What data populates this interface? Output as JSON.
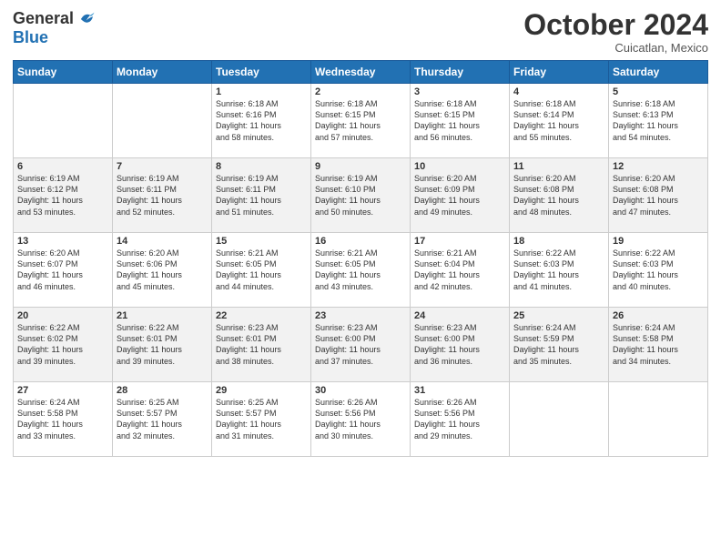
{
  "header": {
    "logo_general": "General",
    "logo_blue": "Blue",
    "month_title": "October 2024",
    "location": "Cuicatlan, Mexico"
  },
  "weekdays": [
    "Sunday",
    "Monday",
    "Tuesday",
    "Wednesday",
    "Thursday",
    "Friday",
    "Saturday"
  ],
  "days": [
    {
      "num": "",
      "sunrise": "",
      "sunset": "",
      "daylight": ""
    },
    {
      "num": "",
      "sunrise": "",
      "sunset": "",
      "daylight": ""
    },
    {
      "num": "1",
      "sunrise": "Sunrise: 6:18 AM",
      "sunset": "Sunset: 6:16 PM",
      "daylight": "Daylight: 11 hours and 58 minutes."
    },
    {
      "num": "2",
      "sunrise": "Sunrise: 6:18 AM",
      "sunset": "Sunset: 6:15 PM",
      "daylight": "Daylight: 11 hours and 57 minutes."
    },
    {
      "num": "3",
      "sunrise": "Sunrise: 6:18 AM",
      "sunset": "Sunset: 6:15 PM",
      "daylight": "Daylight: 11 hours and 56 minutes."
    },
    {
      "num": "4",
      "sunrise": "Sunrise: 6:18 AM",
      "sunset": "Sunset: 6:14 PM",
      "daylight": "Daylight: 11 hours and 55 minutes."
    },
    {
      "num": "5",
      "sunrise": "Sunrise: 6:18 AM",
      "sunset": "Sunset: 6:13 PM",
      "daylight": "Daylight: 11 hours and 54 minutes."
    },
    {
      "num": "6",
      "sunrise": "Sunrise: 6:19 AM",
      "sunset": "Sunset: 6:12 PM",
      "daylight": "Daylight: 11 hours and 53 minutes."
    },
    {
      "num": "7",
      "sunrise": "Sunrise: 6:19 AM",
      "sunset": "Sunset: 6:11 PM",
      "daylight": "Daylight: 11 hours and 52 minutes."
    },
    {
      "num": "8",
      "sunrise": "Sunrise: 6:19 AM",
      "sunset": "Sunset: 6:11 PM",
      "daylight": "Daylight: 11 hours and 51 minutes."
    },
    {
      "num": "9",
      "sunrise": "Sunrise: 6:19 AM",
      "sunset": "Sunset: 6:10 PM",
      "daylight": "Daylight: 11 hours and 50 minutes."
    },
    {
      "num": "10",
      "sunrise": "Sunrise: 6:20 AM",
      "sunset": "Sunset: 6:09 PM",
      "daylight": "Daylight: 11 hours and 49 minutes."
    },
    {
      "num": "11",
      "sunrise": "Sunrise: 6:20 AM",
      "sunset": "Sunset: 6:08 PM",
      "daylight": "Daylight: 11 hours and 48 minutes."
    },
    {
      "num": "12",
      "sunrise": "Sunrise: 6:20 AM",
      "sunset": "Sunset: 6:08 PM",
      "daylight": "Daylight: 11 hours and 47 minutes."
    },
    {
      "num": "13",
      "sunrise": "Sunrise: 6:20 AM",
      "sunset": "Sunset: 6:07 PM",
      "daylight": "Daylight: 11 hours and 46 minutes."
    },
    {
      "num": "14",
      "sunrise": "Sunrise: 6:20 AM",
      "sunset": "Sunset: 6:06 PM",
      "daylight": "Daylight: 11 hours and 45 minutes."
    },
    {
      "num": "15",
      "sunrise": "Sunrise: 6:21 AM",
      "sunset": "Sunset: 6:05 PM",
      "daylight": "Daylight: 11 hours and 44 minutes."
    },
    {
      "num": "16",
      "sunrise": "Sunrise: 6:21 AM",
      "sunset": "Sunset: 6:05 PM",
      "daylight": "Daylight: 11 hours and 43 minutes."
    },
    {
      "num": "17",
      "sunrise": "Sunrise: 6:21 AM",
      "sunset": "Sunset: 6:04 PM",
      "daylight": "Daylight: 11 hours and 42 minutes."
    },
    {
      "num": "18",
      "sunrise": "Sunrise: 6:22 AM",
      "sunset": "Sunset: 6:03 PM",
      "daylight": "Daylight: 11 hours and 41 minutes."
    },
    {
      "num": "19",
      "sunrise": "Sunrise: 6:22 AM",
      "sunset": "Sunset: 6:03 PM",
      "daylight": "Daylight: 11 hours and 40 minutes."
    },
    {
      "num": "20",
      "sunrise": "Sunrise: 6:22 AM",
      "sunset": "Sunset: 6:02 PM",
      "daylight": "Daylight: 11 hours and 39 minutes."
    },
    {
      "num": "21",
      "sunrise": "Sunrise: 6:22 AM",
      "sunset": "Sunset: 6:01 PM",
      "daylight": "Daylight: 11 hours and 39 minutes."
    },
    {
      "num": "22",
      "sunrise": "Sunrise: 6:23 AM",
      "sunset": "Sunset: 6:01 PM",
      "daylight": "Daylight: 11 hours and 38 minutes."
    },
    {
      "num": "23",
      "sunrise": "Sunrise: 6:23 AM",
      "sunset": "Sunset: 6:00 PM",
      "daylight": "Daylight: 11 hours and 37 minutes."
    },
    {
      "num": "24",
      "sunrise": "Sunrise: 6:23 AM",
      "sunset": "Sunset: 6:00 PM",
      "daylight": "Daylight: 11 hours and 36 minutes."
    },
    {
      "num": "25",
      "sunrise": "Sunrise: 6:24 AM",
      "sunset": "Sunset: 5:59 PM",
      "daylight": "Daylight: 11 hours and 35 minutes."
    },
    {
      "num": "26",
      "sunrise": "Sunrise: 6:24 AM",
      "sunset": "Sunset: 5:58 PM",
      "daylight": "Daylight: 11 hours and 34 minutes."
    },
    {
      "num": "27",
      "sunrise": "Sunrise: 6:24 AM",
      "sunset": "Sunset: 5:58 PM",
      "daylight": "Daylight: 11 hours and 33 minutes."
    },
    {
      "num": "28",
      "sunrise": "Sunrise: 6:25 AM",
      "sunset": "Sunset: 5:57 PM",
      "daylight": "Daylight: 11 hours and 32 minutes."
    },
    {
      "num": "29",
      "sunrise": "Sunrise: 6:25 AM",
      "sunset": "Sunset: 5:57 PM",
      "daylight": "Daylight: 11 hours and 31 minutes."
    },
    {
      "num": "30",
      "sunrise": "Sunrise: 6:26 AM",
      "sunset": "Sunset: 5:56 PM",
      "daylight": "Daylight: 11 hours and 30 minutes."
    },
    {
      "num": "31",
      "sunrise": "Sunrise: 6:26 AM",
      "sunset": "Sunset: 5:56 PM",
      "daylight": "Daylight: 11 hours and 29 minutes."
    },
    {
      "num": "",
      "sunrise": "",
      "sunset": "",
      "daylight": ""
    },
    {
      "num": "",
      "sunrise": "",
      "sunset": "",
      "daylight": ""
    }
  ]
}
